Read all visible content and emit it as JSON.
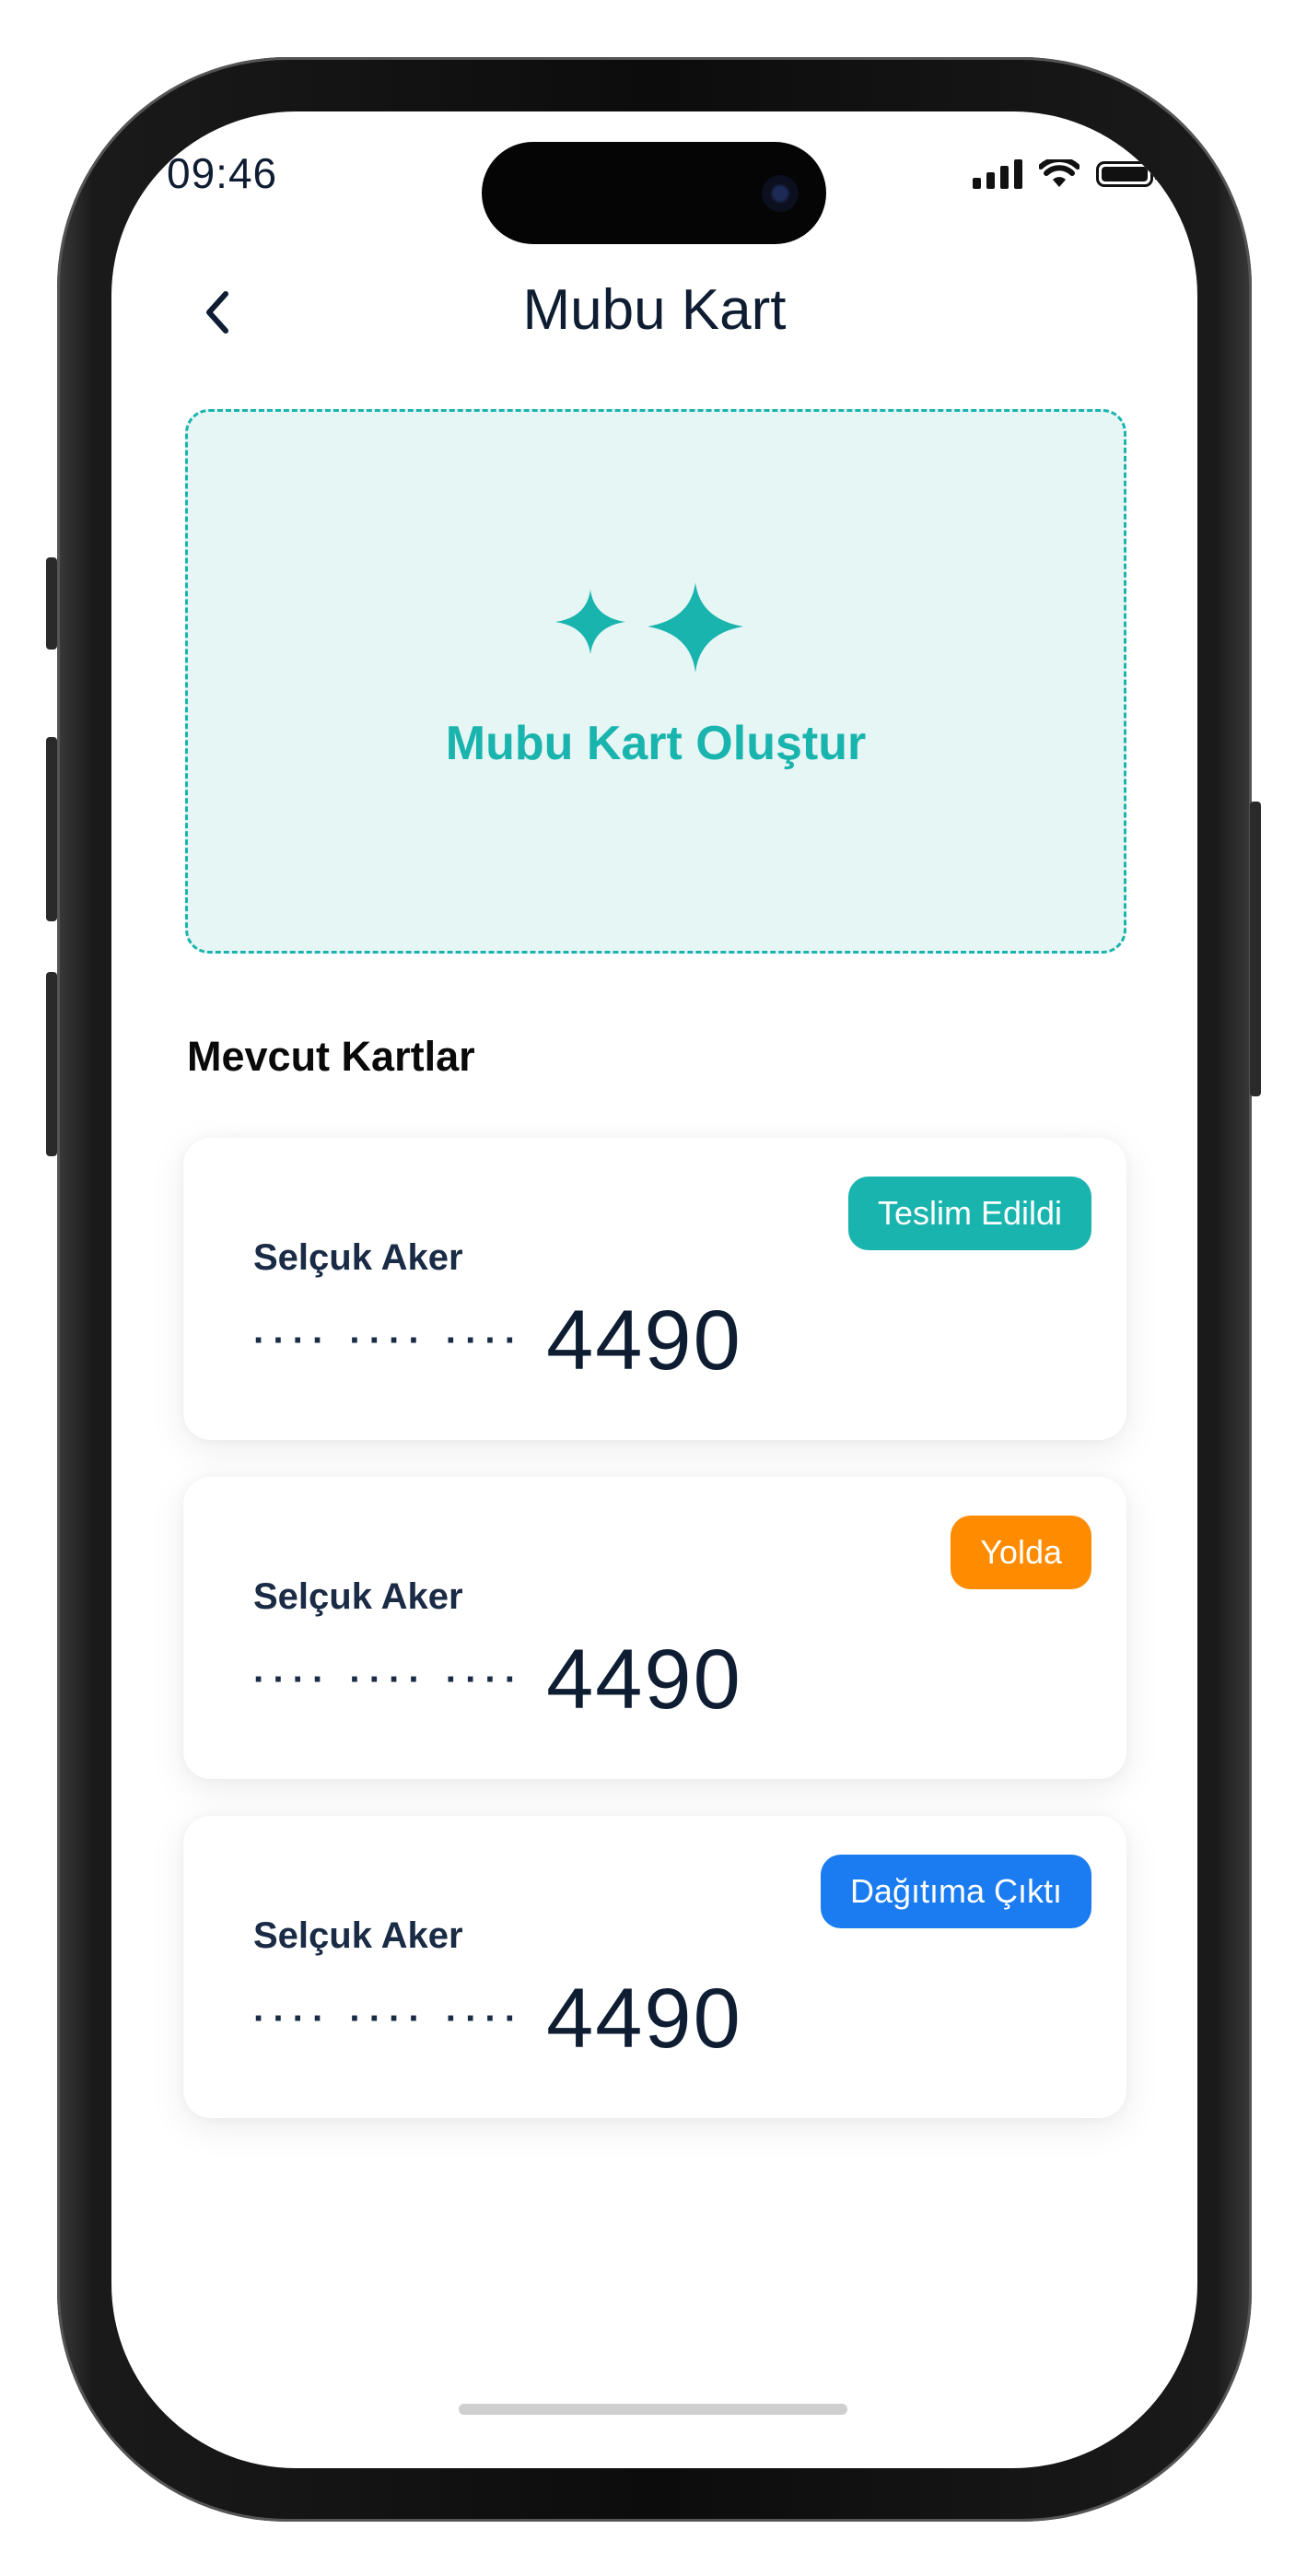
{
  "status_bar": {
    "time": "09:46"
  },
  "header": {
    "title": "Mubu Kart"
  },
  "create_card": {
    "label": "Mubu Kart Oluştur"
  },
  "section": {
    "title": "Mevcut Kartlar"
  },
  "cards": [
    {
      "name": "Selçuk Aker",
      "masked": "···· ···· ····",
      "last4": "4490",
      "status": "Teslim Edildi",
      "status_color": "#19b4ae"
    },
    {
      "name": "Selçuk Aker",
      "masked": "···· ···· ····",
      "last4": "4490",
      "status": "Yolda",
      "status_color": "#ff8c00"
    },
    {
      "name": "Selçuk Aker",
      "masked": "···· ···· ····",
      "last4": "4490",
      "status": "Dağıtıma Çıktı",
      "status_color": "#1a7cf0"
    }
  ],
  "colors": {
    "accent": "#19b4ae",
    "text_dark": "#0f1d32",
    "create_bg": "#e6f6f5"
  },
  "icons": {
    "back": "chevron-left-icon",
    "create": "sparkles-icon",
    "signal": "cellular-signal-icon",
    "wifi": "wifi-icon",
    "battery": "battery-icon"
  }
}
